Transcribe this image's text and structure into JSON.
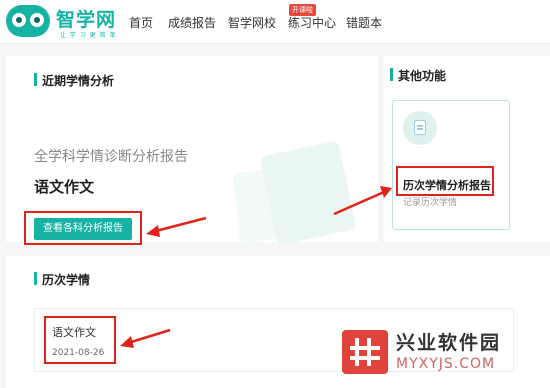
{
  "brand": {
    "name": "智学网",
    "slogan": "让 学 习 更 简 单"
  },
  "nav": {
    "items": [
      "首页",
      "成绩报告",
      "智学网校",
      "练习中心",
      "错题本"
    ],
    "badge": "开课啦"
  },
  "recent": {
    "title": "近期学情分析",
    "report_heading": "全学科学情诊断分析报告",
    "subject": "语文作文",
    "view_button": "查看各科分析报告"
  },
  "other": {
    "title": "其他功能",
    "feature_icon": "document-icon",
    "feature_title": "历次学情分析报告",
    "feature_desc": "记录历次学情"
  },
  "history": {
    "title": "历次学情",
    "record": {
      "subject": "语文作文",
      "date": "2021-08-26"
    }
  },
  "watermark": {
    "title": "兴业软件园",
    "url": "MYXYJS.COM"
  },
  "colors": {
    "accent": "#16b3a5",
    "highlight": "#e0241c"
  }
}
